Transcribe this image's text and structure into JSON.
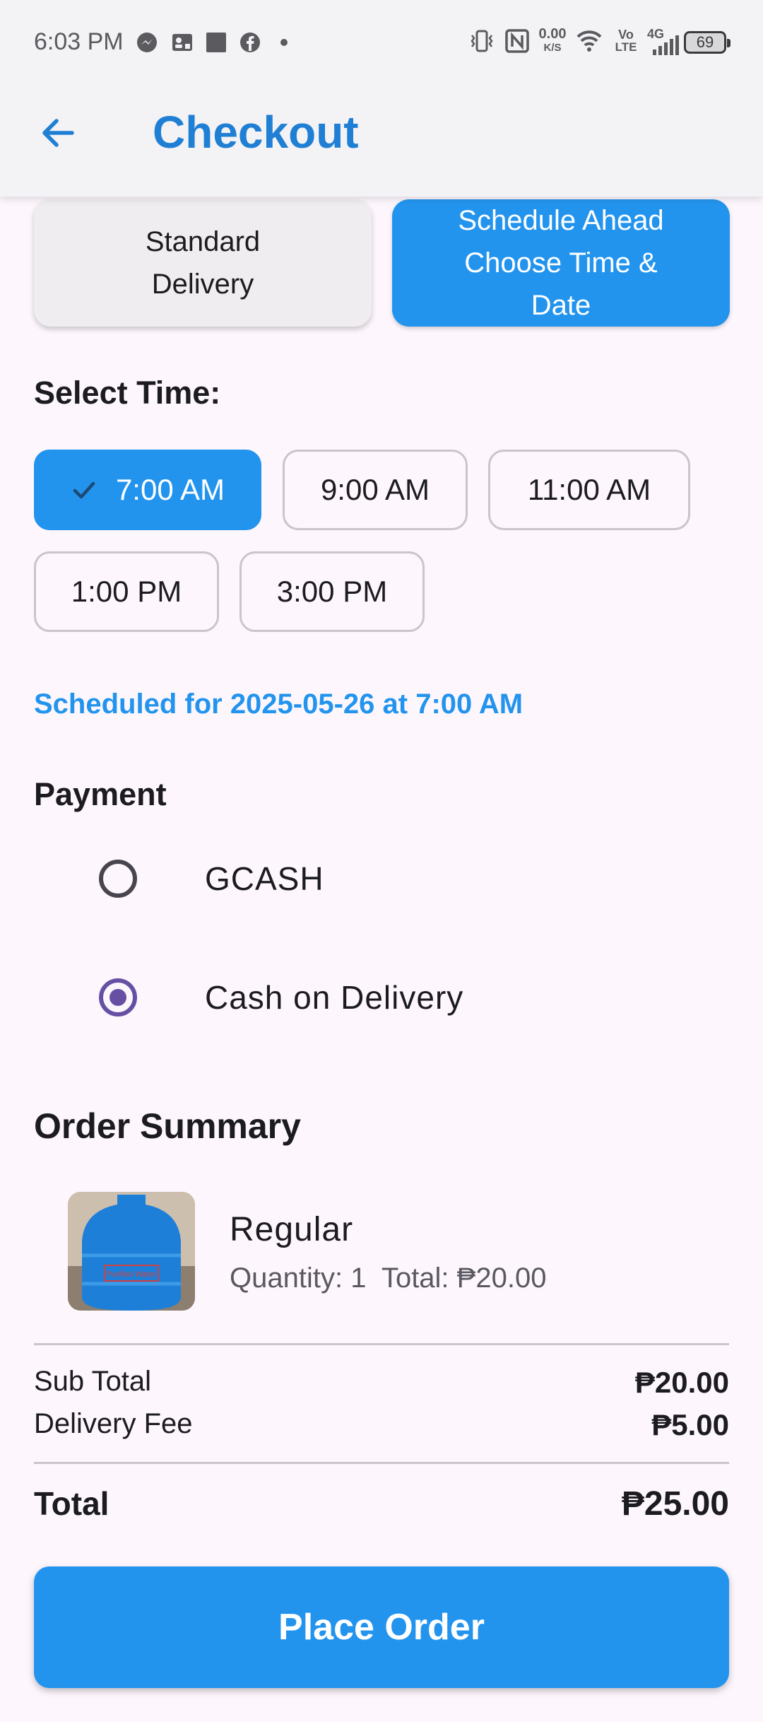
{
  "status_bar": {
    "time": "6:03 PM",
    "left_icons": [
      "messenger-icon",
      "contact-card-icon",
      "square-app-icon",
      "facebook-icon",
      "dot-icon"
    ],
    "net_speed_value": "0.00",
    "net_speed_unit": "K/S",
    "volte_top": "Vo",
    "volte_bottom": "LTE",
    "network": "4G",
    "battery": "69"
  },
  "app_bar": {
    "title": "Checkout",
    "back_icon": "arrow-left-icon"
  },
  "delivery": {
    "standard_label": "Standard\nDelivery",
    "schedule_label": "Schedule Ahead\nChoose Time &\nDate",
    "selected": "schedule"
  },
  "time": {
    "heading": "Select Time:",
    "slots": [
      "7:00 AM",
      "9:00 AM",
      "11:00 AM",
      "1:00 PM",
      "3:00 PM"
    ],
    "selected": "7:00 AM",
    "scheduled_note": "Scheduled for 2025-05-26 at 7:00 AM"
  },
  "payment": {
    "heading": "Payment",
    "options": [
      "GCASH",
      "Cash on Delivery"
    ],
    "selected": "Cash on Delivery"
  },
  "summary": {
    "heading": "Order Summary",
    "item_name": "Regular",
    "item_meta": "Quantity: 1  Total: ₱20.00",
    "product_label": "Purified Water",
    "subtotal_label": "Sub Total",
    "subtotal_value": "₱20.00",
    "delivery_fee_label": "Delivery Fee",
    "delivery_fee_value": "₱5.00",
    "total_label": "Total",
    "total_value": "₱25.00"
  },
  "place_order_label": "Place Order",
  "colors": {
    "primary": "#2394ee",
    "title_blue": "#1f7fd4",
    "radio_purple": "#6750a4",
    "background": "#fdf7fd"
  }
}
